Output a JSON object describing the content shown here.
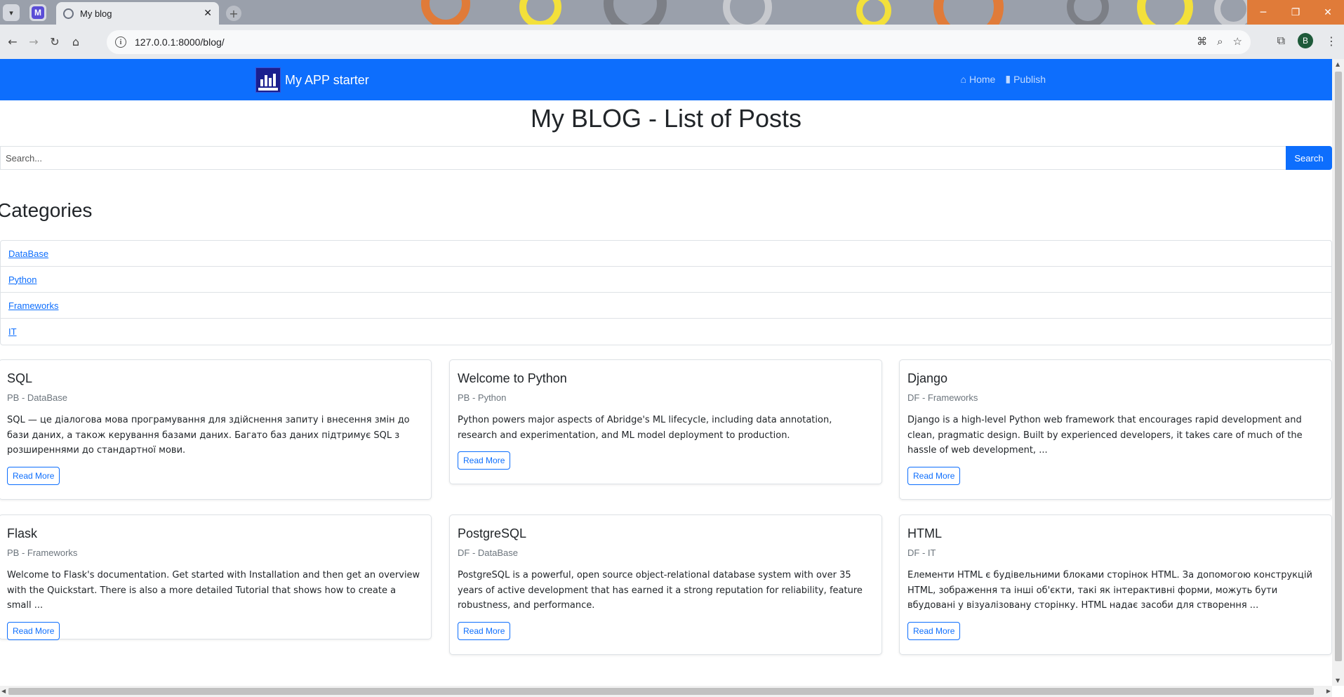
{
  "browser": {
    "tab_title": "My blog",
    "app_badge": "M",
    "new_tab": "+",
    "close_tab": "✕",
    "url": "127.0.0.1:8000/blog/",
    "profile_initial": "B"
  },
  "navbar": {
    "brand": "My APP starter",
    "links": [
      {
        "label": "Home",
        "icon": "home-icon"
      },
      {
        "label": "Publish",
        "icon": "book-icon"
      }
    ],
    "color": "#0d6efd"
  },
  "page": {
    "title": "My BLOG - List of Posts"
  },
  "search": {
    "placeholder": "Search...",
    "button": "Search"
  },
  "categories": {
    "heading": "Categories",
    "items": [
      "DataBase",
      "Python",
      "Frameworks",
      "IT"
    ]
  },
  "posts": [
    {
      "title": "SQL",
      "meta": "PB - DataBase",
      "excerpt": "SQL — це діалогова мова програмування для здійснення запиту і внесення змін до бази даних, а також керування базами даних. Багато баз даних підтримує SQL з розширеннями до стандартної мови.",
      "button": "Read More"
    },
    {
      "title": "Welcome to Python",
      "meta": "PB - Python",
      "excerpt": "Python powers major aspects of Abridge's ML lifecycle, including data annotation, research and experimentation, and ML model deployment to production.",
      "button": "Read More"
    },
    {
      "title": "Django",
      "meta": "DF - Frameworks",
      "excerpt": "Django is a high-level Python web framework that encourages rapid development and clean, pragmatic design. Built by experienced developers, it takes care of much of the hassle of web development, ...",
      "button": "Read More"
    },
    {
      "title": "Flask",
      "meta": "PB - Frameworks",
      "excerpt": "Welcome to Flask's documentation. Get started with Installation and then get an overview with the Quickstart. There is also a more detailed Tutorial that shows how to create a small ...",
      "button": "Read More"
    },
    {
      "title": "PostgreSQL",
      "meta": "DF - DataBase",
      "excerpt": "PostgreSQL is a powerful, open source object-relational database system with over 35 years of active development that has earned it a strong reputation for reliability, feature robustness, and performance.",
      "button": "Read More"
    },
    {
      "title": "HTML",
      "meta": "DF - IT",
      "excerpt": "Елементи HTML є будівельними блоками сторінок HTML. За допомогою конструкцій HTML, зображення та інші об'єкти, такі як інтерактивні форми, можуть бути вбудовані у візуалізовану сторінку. HTML надає засоби для створення ...",
      "button": "Read More"
    }
  ]
}
